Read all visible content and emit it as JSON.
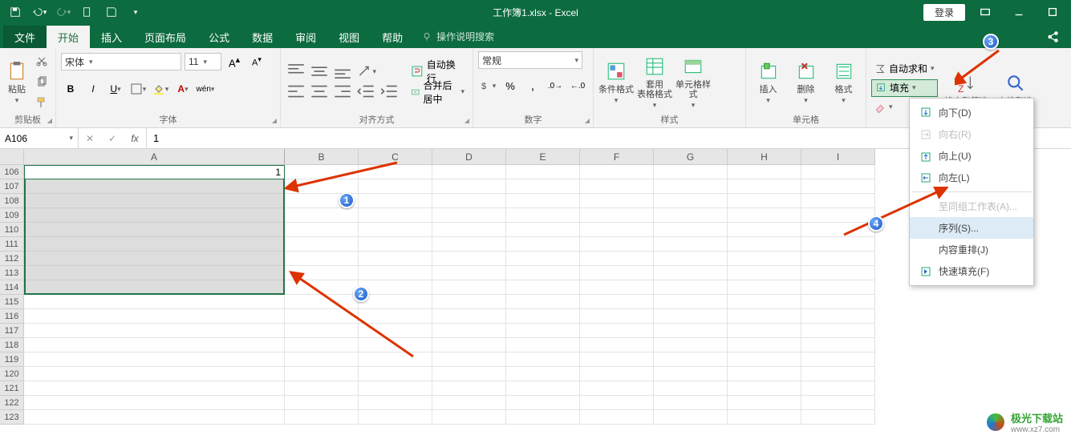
{
  "qat": {
    "title": "工作簿1.xlsx - Excel",
    "login": "登录"
  },
  "tabs": {
    "file": "文件",
    "home": "开始",
    "insert": "插入",
    "pagelayout": "页面布局",
    "formulas": "公式",
    "data": "数据",
    "review": "审阅",
    "view": "视图",
    "help": "帮助",
    "tellme": "操作说明搜索"
  },
  "ribbon": {
    "clipboard": {
      "label": "剪贴板",
      "paste": "粘贴"
    },
    "font": {
      "label": "字体",
      "name": "宋体",
      "size": "11",
      "bold": "B",
      "italic": "I",
      "underline": "U",
      "pinyin": "wén"
    },
    "align": {
      "label": "对齐方式",
      "wrap": "自动换行",
      "merge": "合并后居中"
    },
    "number": {
      "label": "数字",
      "format": "常规"
    },
    "styles": {
      "label": "样式",
      "cond": "条件格式",
      "table": "套用\n表格格式",
      "cell": "单元格样式"
    },
    "cells": {
      "label": "单元格",
      "insert": "插入",
      "delete": "删除",
      "format": "格式"
    },
    "editing": {
      "label": "",
      "autosum": "自动求和",
      "fill": "填充",
      "sort": "排序和筛选",
      "find": "查找和选"
    }
  },
  "formula_bar": {
    "name_box": "A106",
    "value": "1"
  },
  "columns": [
    "A",
    "B",
    "C",
    "D",
    "E",
    "F",
    "G",
    "H",
    "I"
  ],
  "rows": [
    106,
    107,
    108,
    109,
    110,
    111,
    112,
    113,
    114,
    115,
    116,
    117,
    118,
    119,
    120,
    121,
    122,
    123
  ],
  "cell_A106": "1",
  "fill_menu": {
    "down": "向下(D)",
    "right": "向右(R)",
    "up": "向上(U)",
    "left": "向左(L)",
    "group": "至同组工作表(A)...",
    "series": "序列(S)...",
    "justify": "内容重排(J)",
    "flash": "快速填充(F)"
  },
  "annotations": {
    "n1": "1",
    "n2": "2",
    "n3": "3",
    "n4": "4"
  },
  "watermark": {
    "name": "极光下载站",
    "url": "www.xz7.com"
  }
}
